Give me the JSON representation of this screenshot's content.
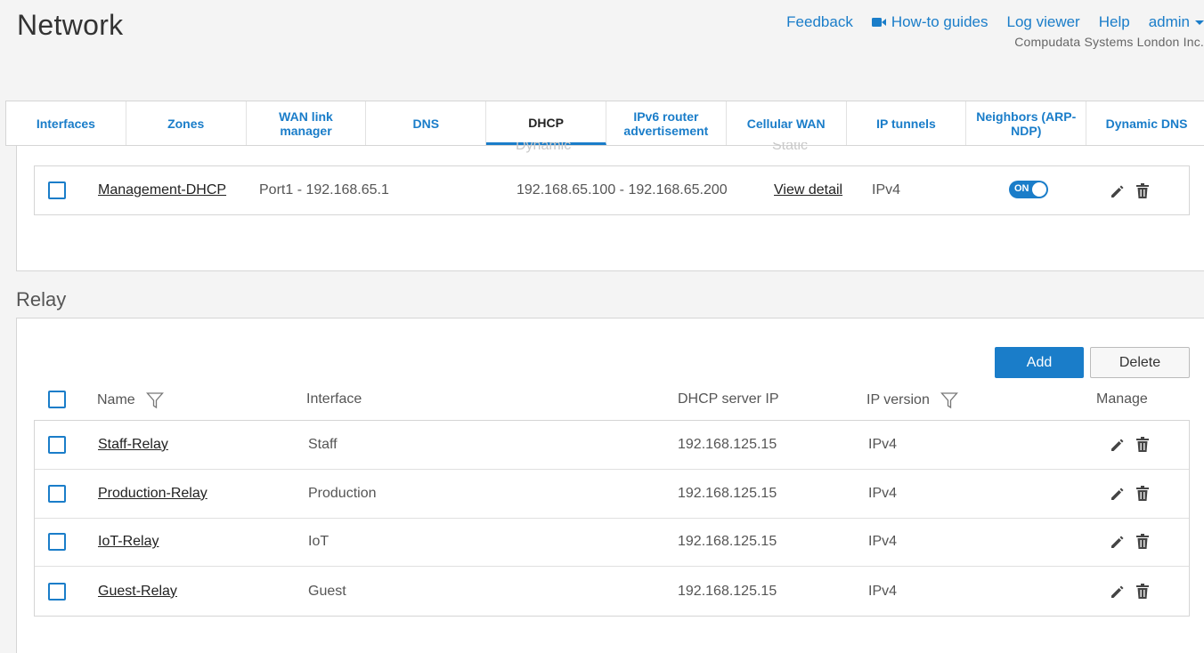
{
  "page": {
    "title": "Network"
  },
  "topnav": {
    "feedback": "Feedback",
    "howto": "How-to guides",
    "logviewer": "Log viewer",
    "help": "Help",
    "admin": "admin",
    "company": "Compudata Systems London Inc."
  },
  "tabs": [
    {
      "label": "Interfaces"
    },
    {
      "label": "Zones"
    },
    {
      "label": "WAN link manager"
    },
    {
      "label": "DNS"
    },
    {
      "label": "DHCP"
    },
    {
      "label": "IPv6 router advertisement"
    },
    {
      "label": "Cellular WAN"
    },
    {
      "label": "IP tunnels"
    },
    {
      "label": "Neighbors (ARP-NDP)"
    },
    {
      "label": "Dynamic DNS"
    }
  ],
  "active_tab": "DHCP",
  "server_section": {
    "partial_headers": {
      "dynamic": "Dynamic",
      "static": "Static"
    },
    "row": {
      "name": "Management-DHCP",
      "interface": "Port1 - 192.168.65.1",
      "dynamic": "192.168.65.100 - 192.168.65.200",
      "static": "View detail",
      "ip_version": "IPv4",
      "toggle": "ON"
    }
  },
  "relay_section": {
    "title": "Relay",
    "add_label": "Add",
    "delete_label": "Delete",
    "headers": {
      "name": "Name",
      "interface": "Interface",
      "dhcp_server_ip": "DHCP server IP",
      "ip_version": "IP version",
      "manage": "Manage"
    },
    "rows": [
      {
        "name": "Staff-Relay",
        "interface": "Staff",
        "server": "192.168.125.15",
        "version": "IPv4"
      },
      {
        "name": "Production-Relay",
        "interface": "Production",
        "server": "192.168.125.15",
        "version": "IPv4"
      },
      {
        "name": "IoT-Relay",
        "interface": "IoT",
        "server": "192.168.125.15",
        "version": "IPv4"
      },
      {
        "name": "Guest-Relay",
        "interface": "Guest",
        "server": "192.168.125.15",
        "version": "IPv4"
      }
    ]
  },
  "colors": {
    "accent": "#1a7dc9",
    "background": "#f4f4f4",
    "panel": "#ffffff"
  }
}
